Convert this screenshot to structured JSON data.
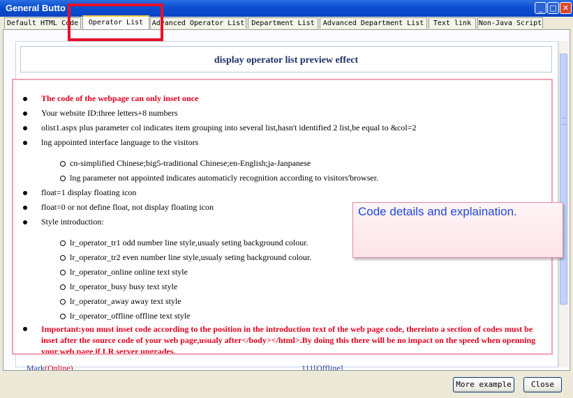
{
  "window": {
    "title": "General Butto"
  },
  "tabs": [
    {
      "label": "Default HTML Code"
    },
    {
      "label": "Operator List"
    },
    {
      "label": "Advanced Operator List"
    },
    {
      "label": "Department List"
    },
    {
      "label": "Advanced Department List"
    },
    {
      "label": "Text link"
    },
    {
      "label": "Non-Java Script"
    }
  ],
  "preview": {
    "header": "display operator list preview effect"
  },
  "details": {
    "items": [
      {
        "text": "The code of the webpage can only inset once"
      },
      {
        "text": "Your website ID:three letters+8 numbers"
      },
      {
        "text": "olist1.aspx plus parameter col indicates item grouping into several list,hasn't identified 2 list,be equal to &col=2"
      },
      {
        "text": "lng appointed interface language to the visitors"
      },
      {
        "text": "cn-simplified Chinese;big5-traditional Chinese;en-English;ja-Janpanese"
      },
      {
        "text": "lng parameter not appointed indicates automaticly recognition according to visitors'browser."
      },
      {
        "text": "float=1 display floating icon"
      },
      {
        "text": "float=0 or not define float, not display floating icon"
      },
      {
        "text": "Style introduction:"
      },
      {
        "text": "lr_operator_tr1 odd number line style,usualy seting background colour."
      },
      {
        "text": "lr_operator_tr2 even number line style,usualy seting background colour."
      },
      {
        "text": "lr_operator_online online text style"
      },
      {
        "text": "lr_operator_busy busy text style"
      },
      {
        "text": "lr_operator_away away text style"
      },
      {
        "text": "lr_operator_offline offline text style"
      }
    ],
    "important": "Important:you must inset code according to the position in the introduction text of the web page code, thereinto a section of codes must be inset after the source code of your web page,usualy after</body></html>.By doing this there will be no impact on the speed when openning your web page if LR server upgrades."
  },
  "callout": {
    "text": "Code details and explaination."
  },
  "operators": {
    "left_name": "Mark",
    "left_status": "(Online)",
    "right_name": "111",
    "right_status": "[Offline]"
  },
  "buttons": {
    "more_example": "More example",
    "close": "Close"
  },
  "colors": {
    "highlight_box": "#e8102a",
    "important_text": "#e0001c",
    "callout_text": "#1f48d8"
  }
}
